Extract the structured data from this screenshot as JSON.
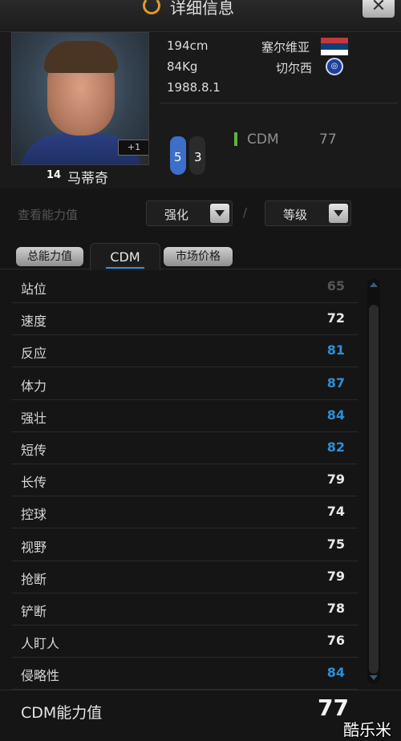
{
  "window": {
    "title": "详细信息",
    "close_label": "✕"
  },
  "player": {
    "height": "194cm",
    "weight": "84Kg",
    "birthdate": "1988.8.1",
    "nationality": "塞尔维亚",
    "club": "切尔西",
    "jersey_number": "14",
    "name": "马蒂奇",
    "plus_badge": "+1",
    "foot_left": "5",
    "foot_right": "3",
    "position": "CDM",
    "position_rating": "77"
  },
  "filters": {
    "label": "查看能力值",
    "enhance": "强化",
    "separator": "/",
    "level": "等级"
  },
  "tabs": {
    "overall": "总能力值",
    "cdm": "CDM",
    "market": "市场价格"
  },
  "stats": [
    {
      "label": "站位",
      "value": "65",
      "color": "#555555"
    },
    {
      "label": "速度",
      "value": "72",
      "color": "#e8e8e8"
    },
    {
      "label": "反应",
      "value": "81",
      "color": "#2e8fd6"
    },
    {
      "label": "体力",
      "value": "87",
      "color": "#2e8fd6"
    },
    {
      "label": "强壮",
      "value": "84",
      "color": "#2e8fd6"
    },
    {
      "label": "短传",
      "value": "82",
      "color": "#2e8fd6"
    },
    {
      "label": "长传",
      "value": "79",
      "color": "#e8e8e8"
    },
    {
      "label": "控球",
      "value": "74",
      "color": "#e8e8e8"
    },
    {
      "label": "视野",
      "value": "75",
      "color": "#e8e8e8"
    },
    {
      "label": "抢断",
      "value": "79",
      "color": "#e8e8e8"
    },
    {
      "label": "铲断",
      "value": "78",
      "color": "#e8e8e8"
    },
    {
      "label": "人盯人",
      "value": "76",
      "color": "#e8e8e8"
    },
    {
      "label": "侵略性",
      "value": "84",
      "color": "#2e8fd6"
    }
  ],
  "summary": {
    "label": "CDM能力值",
    "value": "77"
  },
  "watermark": "酷乐米"
}
